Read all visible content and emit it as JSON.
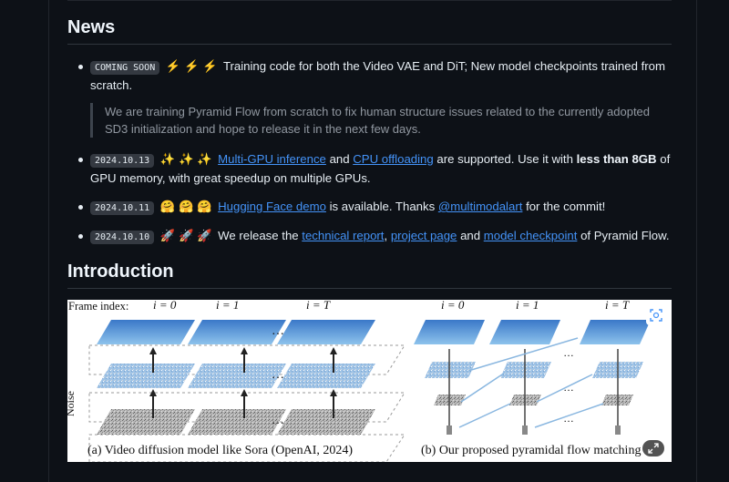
{
  "news": {
    "heading": "News",
    "items": [
      {
        "badge": "COMING SOON",
        "emojis": "⚡ ⚡ ⚡",
        "text_1": "Training code for both the Video VAE and DiT; New model checkpoints trained from scratch.",
        "quote": "We are training Pyramid Flow from scratch to fix human structure issues related to the currently adopted SD3 initialization and hope to release it in the next few days."
      },
      {
        "badge": "2024.10.13",
        "emojis": "✨ ✨ ✨",
        "link_1": "Multi-GPU inference",
        "text_1": "and",
        "link_2": "CPU offloading",
        "text_2": "are supported. Use it with",
        "bold": "less than 8GB",
        "text_3": "of GPU memory, with great speedup on multiple GPUs."
      },
      {
        "badge": "2024.10.11",
        "emojis": "🤗 🤗 🤗",
        "link_1": "Hugging Face demo",
        "text_1": "is available. Thanks",
        "link_2": "@multimodalart",
        "text_2": "for the commit!"
      },
      {
        "badge": "2024.10.10",
        "emojis": "🚀 🚀 🚀",
        "text_1": "We release the",
        "link_1": "technical report",
        "sep_1": ",",
        "link_2": "project page",
        "text_2": "and",
        "link_3": "model checkpoint",
        "text_3": "of Pyramid Flow."
      }
    ]
  },
  "introduction": {
    "heading": "Introduction",
    "figure": {
      "frame_index_label": "Frame index:",
      "left_labels": [
        "i = 0",
        "i = 1",
        "i = T"
      ],
      "right_labels": [
        "i = 0",
        "i = 1",
        "i = T"
      ],
      "noise_label": "Noise",
      "caption_a": "(a) Video diffusion model like Sora (OpenAI, 2024)",
      "caption_b": "(b) Our proposed pyramidal flow matching"
    }
  },
  "colors": {
    "link": "#4493f8",
    "background": "#0d1117",
    "text": "#e6edf3",
    "quote": "#9198a1"
  },
  "icons": [
    "zap-emoji",
    "sparkles-emoji",
    "hugging-face-emoji",
    "rocket-emoji",
    "zoom-icon",
    "expand-icon"
  ]
}
